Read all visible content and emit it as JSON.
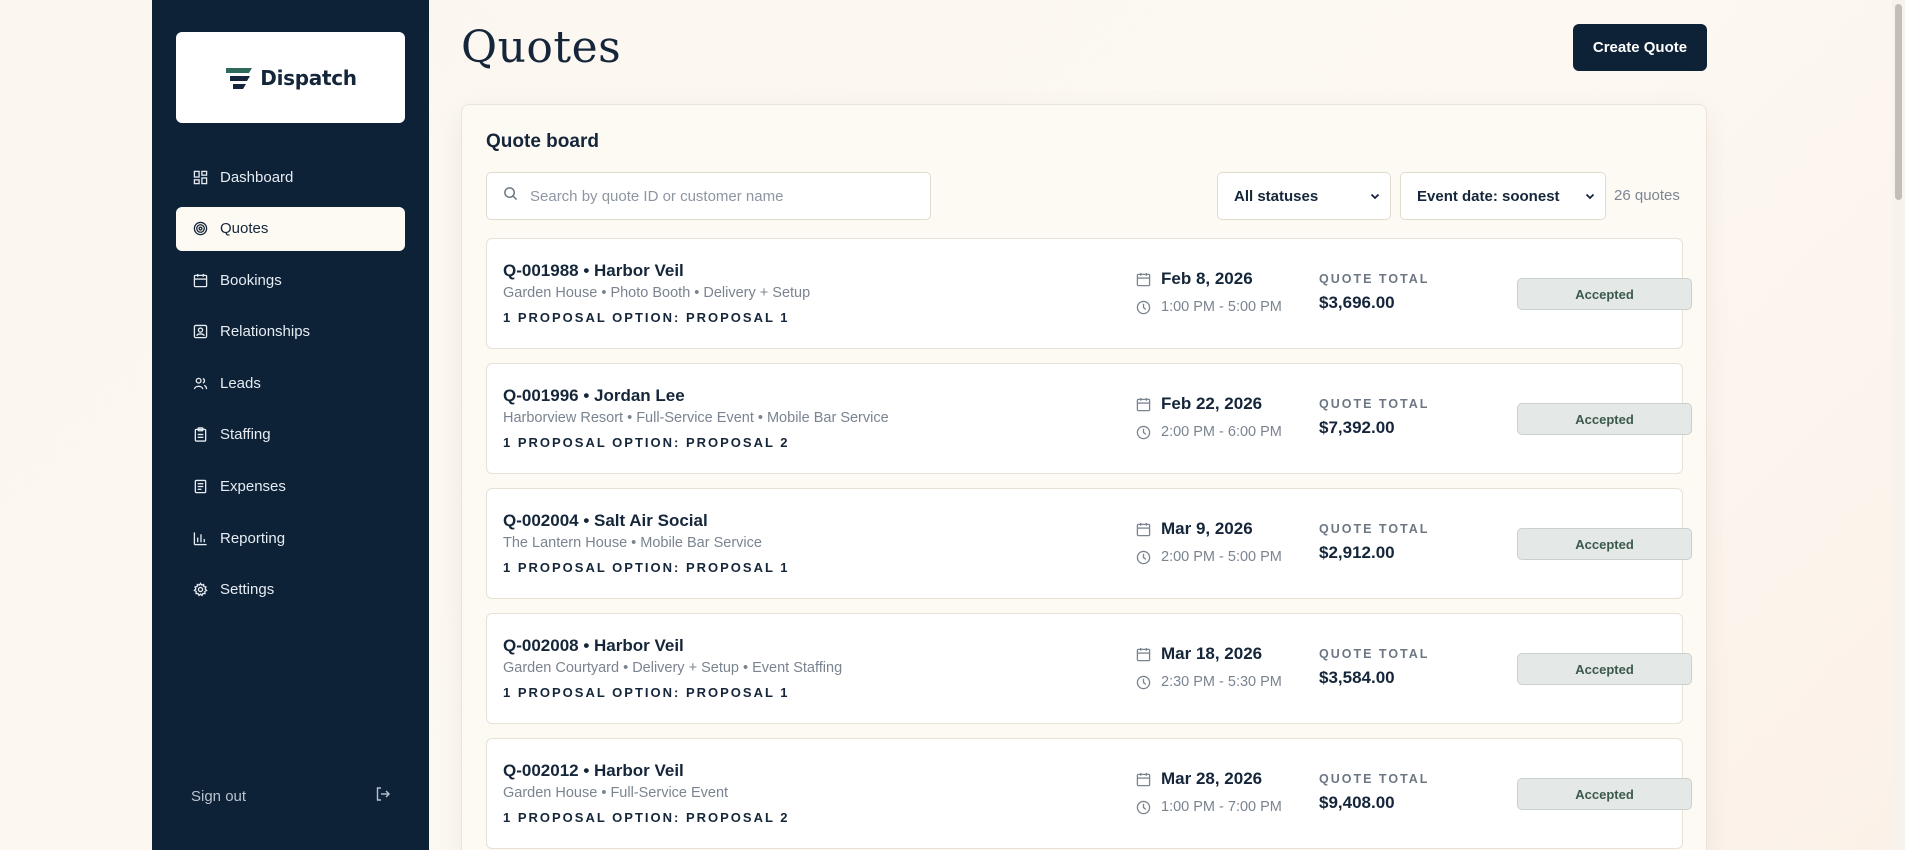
{
  "sidebar": {
    "logo_text": "Dispatch",
    "items": [
      {
        "label": "Dashboard",
        "icon": "grid-icon"
      },
      {
        "label": "Quotes",
        "icon": "target-icon",
        "active": true
      },
      {
        "label": "Bookings",
        "icon": "calendar-icon"
      },
      {
        "label": "Relationships",
        "icon": "contact-card-icon"
      },
      {
        "label": "Leads",
        "icon": "users-icon"
      },
      {
        "label": "Staffing",
        "icon": "clipboard-icon"
      },
      {
        "label": "Expenses",
        "icon": "receipt-icon"
      },
      {
        "label": "Reporting",
        "icon": "bar-chart-icon"
      },
      {
        "label": "Settings",
        "icon": "gear-icon"
      }
    ],
    "sign_out": "Sign out"
  },
  "header": {
    "title": "Quotes",
    "create_button": "Create Quote"
  },
  "board": {
    "title": "Quote board",
    "search_placeholder": "Search by quote ID or customer name",
    "status_filter": "All statuses",
    "sort": "Event date: soonest",
    "count": "26 quotes",
    "total_label": "QUOTE TOTAL",
    "quotes": [
      {
        "title": "Q-001988 • Harbor Veil",
        "details": "Garden House • Photo Booth • Delivery + Setup",
        "option": "1 PROPOSAL OPTION: PROPOSAL 1",
        "date": "Feb 8, 2026",
        "time": "1:00 PM - 5:00 PM",
        "total": "$3,696.00",
        "status": "Accepted"
      },
      {
        "title": "Q-001996 • Jordan Lee",
        "details": "Harborview Resort • Full-Service Event • Mobile Bar Service",
        "option": "1 PROPOSAL OPTION: PROPOSAL 2",
        "date": "Feb 22, 2026",
        "time": "2:00 PM - 6:00 PM",
        "total": "$7,392.00",
        "status": "Accepted"
      },
      {
        "title": "Q-002004 • Salt Air Social",
        "details": "The Lantern House • Mobile Bar Service",
        "option": "1 PROPOSAL OPTION: PROPOSAL 1",
        "date": "Mar 9, 2026",
        "time": "2:00 PM - 5:00 PM",
        "total": "$2,912.00",
        "status": "Accepted"
      },
      {
        "title": "Q-002008 • Harbor Veil",
        "details": "Garden Courtyard • Delivery + Setup • Event Staffing",
        "option": "1 PROPOSAL OPTION: PROPOSAL 1",
        "date": "Mar 18, 2026",
        "time": "2:30 PM - 5:30 PM",
        "total": "$3,584.00",
        "status": "Accepted"
      },
      {
        "title": "Q-002012 • Harbor Veil",
        "details": "Garden House • Full-Service Event",
        "option": "1 PROPOSAL OPTION: PROPOSAL 2",
        "date": "Mar 28, 2026",
        "time": "1:00 PM - 7:00 PM",
        "total": "$9,408.00",
        "status": "Accepted"
      }
    ]
  },
  "colors": {
    "sidebar_bg": "#0d2137",
    "accent": "#0d2137",
    "badge_bg": "#e4e8e6",
    "badge_text": "#3c5a4c",
    "page_bg": "#fbf6f0"
  }
}
